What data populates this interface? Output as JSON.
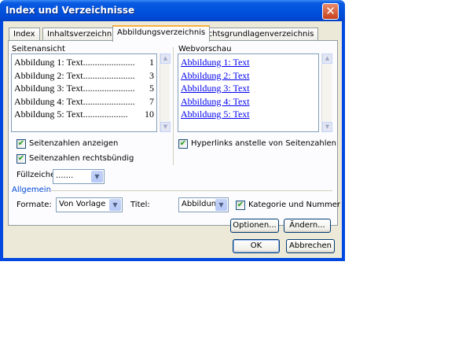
{
  "window": {
    "title": "Index und Verzeichnisse",
    "close_glyph": "✕"
  },
  "tabs": [
    {
      "label": "Index",
      "active": false
    },
    {
      "label": "Inhaltsverzeichnis",
      "active": false
    },
    {
      "label": "Abbildungsverzeichnis",
      "active": true
    },
    {
      "label": "Rechtsgrundlagenverzeichnis",
      "active": false
    }
  ],
  "print_preview": {
    "label": "Seitenansicht",
    "entries": [
      {
        "text": "Abbildung 1: Text",
        "dots": "......................",
        "page": "1"
      },
      {
        "text": "Abbildung 2: Text",
        "dots": "......................",
        "page": "3"
      },
      {
        "text": "Abbildung 3: Text",
        "dots": "......................",
        "page": "5"
      },
      {
        "text": "Abbildung 4: Text",
        "dots": "......................",
        "page": "7"
      },
      {
        "text": "Abbildung 5: Text",
        "dots": "...................",
        "page": "10"
      }
    ]
  },
  "web_preview": {
    "label": "Webvorschau",
    "entries": [
      "Abbildung 1: Text",
      "Abbildung 2: Text",
      "Abbildung 3: Text",
      "Abbildung 4: Text",
      "Abbildung 5: Text"
    ]
  },
  "options": {
    "show_page_numbers": {
      "label": "Seitenzahlen anzeigen",
      "checked": true
    },
    "right_align": {
      "label": "Seitenzahlen rechtsbündig",
      "checked": true
    },
    "hyperlinks": {
      "label": "Hyperlinks anstelle von Seitenzahlen",
      "checked": true
    },
    "tab_leader": {
      "label": "Füllzeichen:",
      "value": "......."
    }
  },
  "general": {
    "header": "Allgemein",
    "formats": {
      "label": "Formate:",
      "value": "Von Vorlage"
    },
    "caption": {
      "label": "Titel:",
      "value": "Abbildung"
    },
    "include_label": {
      "label": "Kategorie und Nummer",
      "checked": true
    }
  },
  "buttons": {
    "options": "Optionen...",
    "modify": "Ändern...",
    "ok": "OK",
    "cancel": "Abbrechen"
  },
  "colors": {
    "title_bar": "#0152dc",
    "dialog_face": "#ece9d8",
    "hyperlink": "#0000ee",
    "tab_highlight": "#f7b03d"
  }
}
